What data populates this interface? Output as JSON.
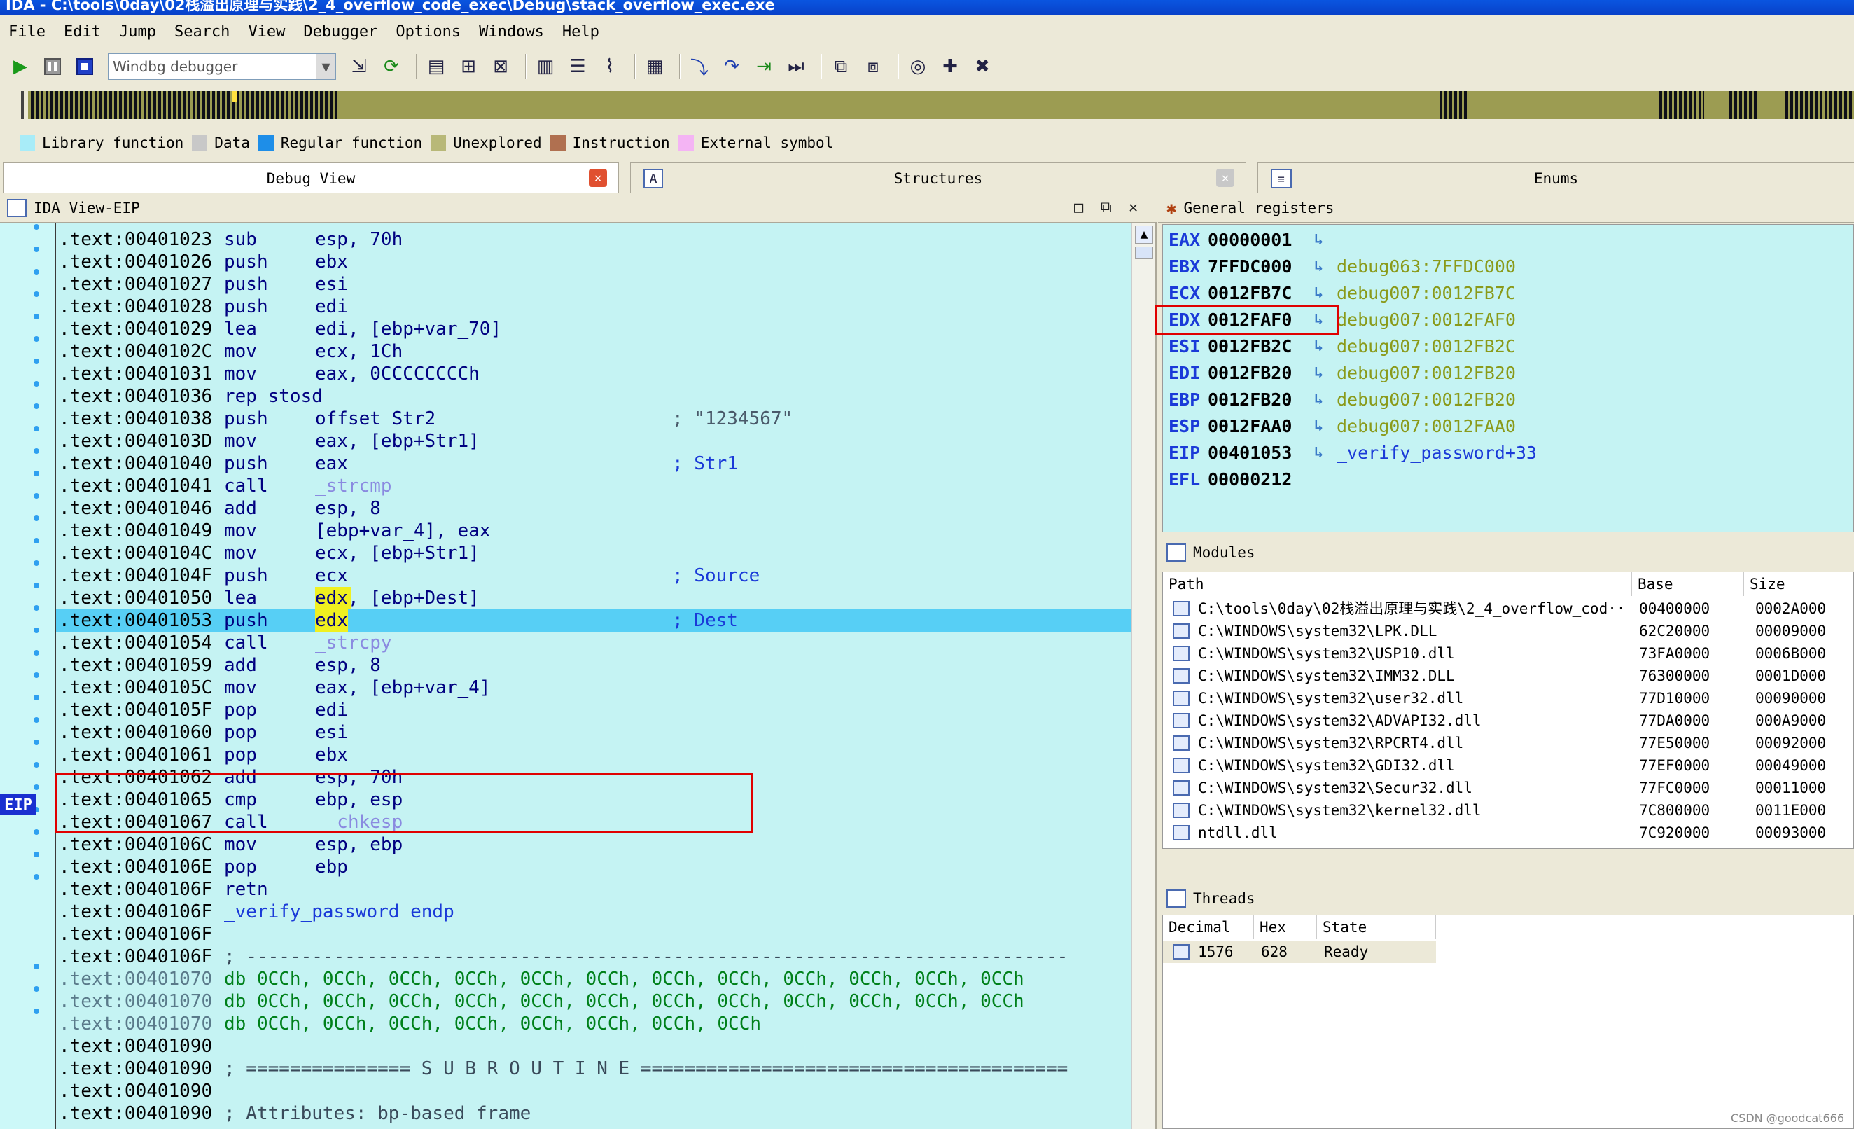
{
  "title": "IDA - C:\\tools\\0day\\02栈溢出原理与实践\\2_4_overflow_code_exec\\Debug\\stack_overflow_exec.exe",
  "menu": [
    "File",
    "Edit",
    "Jump",
    "Search",
    "View",
    "Debugger",
    "Options",
    "Windows",
    "Help"
  ],
  "toolbar": {
    "debugger_select": "Windbg debugger"
  },
  "legend": [
    {
      "label": "Library function",
      "color": "#a8ecf8"
    },
    {
      "label": "Data",
      "color": "#c8c8c8"
    },
    {
      "label": "Regular function",
      "color": "#1e8ee8"
    },
    {
      "label": "Unexplored",
      "color": "#b8b878"
    },
    {
      "label": "Instruction",
      "color": "#b07050"
    },
    {
      "label": "External symbol",
      "color": "#f4b4f4"
    }
  ],
  "tabs": {
    "debug_view": "Debug View",
    "structures": "Structures",
    "enums": "Enums"
  },
  "ida_view": {
    "title": "IDA View-EIP",
    "eip_label": "EIP"
  },
  "code": [
    {
      "a": ".text:00401023",
      "m": "sub",
      "o": "esp, 70h",
      "c": ""
    },
    {
      "a": ".text:00401026",
      "m": "push",
      "o": "ebx",
      "c": ""
    },
    {
      "a": ".text:00401027",
      "m": "push",
      "o": "esi",
      "c": ""
    },
    {
      "a": ".text:00401028",
      "m": "push",
      "o": "edi",
      "c": ""
    },
    {
      "a": ".text:00401029",
      "m": "lea",
      "o": "edi, [ebp+var_70]",
      "c": ""
    },
    {
      "a": ".text:0040102C",
      "m": "mov",
      "o": "ecx, 1Ch",
      "c": ""
    },
    {
      "a": ".text:00401031",
      "m": "mov",
      "o": "eax, 0CCCCCCCCh",
      "c": ""
    },
    {
      "a": ".text:00401036",
      "m": "rep stosd",
      "o": "",
      "c": ""
    },
    {
      "a": ".text:00401038",
      "m": "push",
      "o": "offset Str2",
      "c": "; \"1234567\""
    },
    {
      "a": ".text:0040103D",
      "m": "mov",
      "o": "eax, [ebp+Str1]",
      "c": ""
    },
    {
      "a": ".text:00401040",
      "m": "push",
      "o": "eax",
      "c": "; Str1"
    },
    {
      "a": ".text:00401041",
      "m": "call",
      "o": "_strcmp",
      "c": ""
    },
    {
      "a": ".text:00401046",
      "m": "add",
      "o": "esp, 8",
      "c": ""
    },
    {
      "a": ".text:00401049",
      "m": "mov",
      "o": "[ebp+var_4], eax",
      "c": ""
    },
    {
      "a": ".text:0040104C",
      "m": "mov",
      "o": "ecx, [ebp+Str1]",
      "c": ""
    },
    {
      "a": ".text:0040104F",
      "m": "push",
      "o": "ecx",
      "c": "; Source"
    },
    {
      "a": ".text:00401050",
      "m": "lea",
      "o": "edx, [ebp+Dest]",
      "c": ""
    },
    {
      "a": ".text:00401053",
      "m": "push",
      "o": "edx",
      "c": "; Dest"
    },
    {
      "a": ".text:00401054",
      "m": "call",
      "o": "_strcpy",
      "c": ""
    },
    {
      "a": ".text:00401059",
      "m": "add",
      "o": "esp, 8",
      "c": ""
    },
    {
      "a": ".text:0040105C",
      "m": "mov",
      "o": "eax, [ebp+var_4]",
      "c": ""
    },
    {
      "a": ".text:0040105F",
      "m": "pop",
      "o": "edi",
      "c": ""
    },
    {
      "a": ".text:00401060",
      "m": "pop",
      "o": "esi",
      "c": ""
    },
    {
      "a": ".text:00401061",
      "m": "pop",
      "o": "ebx",
      "c": ""
    },
    {
      "a": ".text:00401062",
      "m": "add",
      "o": "esp, 70h",
      "c": ""
    },
    {
      "a": ".text:00401065",
      "m": "cmp",
      "o": "ebp, esp",
      "c": ""
    },
    {
      "a": ".text:00401067",
      "m": "call",
      "o": "__chkesp",
      "c": ""
    },
    {
      "a": ".text:0040106C",
      "m": "mov",
      "o": "esp, ebp",
      "c": ""
    },
    {
      "a": ".text:0040106E",
      "m": "pop",
      "o": "ebp",
      "c": ""
    },
    {
      "a": ".text:0040106F",
      "m": "retn",
      "o": "",
      "c": ""
    },
    {
      "a": ".text:0040106F",
      "m": "_verify_password endp",
      "o": "",
      "c": ""
    },
    {
      "a": ".text:0040106F",
      "m": "",
      "o": "",
      "c": ""
    },
    {
      "a": ".text:0040106F",
      "m": "; ---------------------------------------------------------------------------",
      "o": "",
      "c": ""
    },
    {
      "a": ".text:00401070",
      "m": "db 0CCh, 0CCh, 0CCh, 0CCh, 0CCh, 0CCh, 0CCh, 0CCh, 0CCh, 0CCh, 0CCh, 0CCh",
      "o": "",
      "c": ""
    },
    {
      "a": ".text:00401070",
      "m": "db 0CCh, 0CCh, 0CCh, 0CCh, 0CCh, 0CCh, 0CCh, 0CCh, 0CCh, 0CCh, 0CCh, 0CCh",
      "o": "",
      "c": ""
    },
    {
      "a": ".text:00401070",
      "m": "db 0CCh, 0CCh, 0CCh, 0CCh, 0CCh, 0CCh, 0CCh, 0CCh",
      "o": "",
      "c": ""
    },
    {
      "a": ".text:00401090",
      "m": "",
      "o": "",
      "c": ""
    },
    {
      "a": ".text:00401090",
      "m": "; =============== S U B R O U T I N E =======================================",
      "o": "",
      "c": ""
    },
    {
      "a": ".text:00401090",
      "m": "",
      "o": "",
      "c": ""
    },
    {
      "a": ".text:00401090",
      "m": "; Attributes: bp-based frame",
      "o": "",
      "c": ""
    }
  ],
  "registers_title": "General registers",
  "registers": [
    {
      "n": "EAX",
      "v": "00000001",
      "t": ""
    },
    {
      "n": "EBX",
      "v": "7FFDC000",
      "t": "debug063:7FFDC000"
    },
    {
      "n": "ECX",
      "v": "0012FB7C",
      "t": "debug007:0012FB7C"
    },
    {
      "n": "EDX",
      "v": "0012FAF0",
      "t": "debug007:0012FAF0"
    },
    {
      "n": "ESI",
      "v": "0012FB2C",
      "t": "debug007:0012FB2C"
    },
    {
      "n": "EDI",
      "v": "0012FB20",
      "t": "debug007:0012FB20"
    },
    {
      "n": "EBP",
      "v": "0012FB20",
      "t": "debug007:0012FB20"
    },
    {
      "n": "ESP",
      "v": "0012FAA0",
      "t": "debug007:0012FAA0"
    },
    {
      "n": "EIP",
      "v": "00401053",
      "t": "_verify_password+33"
    },
    {
      "n": "EFL",
      "v": "00000212",
      "t": ""
    }
  ],
  "modules_title": "Modules",
  "modules_cols": [
    "Path",
    "Base",
    "Size"
  ],
  "modules": [
    {
      "p": "C:\\tools\\0day\\02栈溢出原理与实践\\2_4_overflow_cod···",
      "b": "00400000",
      "s": "0002A000"
    },
    {
      "p": "C:\\WINDOWS\\system32\\LPK.DLL",
      "b": "62C20000",
      "s": "00009000"
    },
    {
      "p": "C:\\WINDOWS\\system32\\USP10.dll",
      "b": "73FA0000",
      "s": "0006B000"
    },
    {
      "p": "C:\\WINDOWS\\system32\\IMM32.DLL",
      "b": "76300000",
      "s": "0001D000"
    },
    {
      "p": "C:\\WINDOWS\\system32\\user32.dll",
      "b": "77D10000",
      "s": "00090000"
    },
    {
      "p": "C:\\WINDOWS\\system32\\ADVAPI32.dll",
      "b": "77DA0000",
      "s": "000A9000"
    },
    {
      "p": "C:\\WINDOWS\\system32\\RPCRT4.dll",
      "b": "77E50000",
      "s": "00092000"
    },
    {
      "p": "C:\\WINDOWS\\system32\\GDI32.dll",
      "b": "77EF0000",
      "s": "00049000"
    },
    {
      "p": "C:\\WINDOWS\\system32\\Secur32.dll",
      "b": "77FC0000",
      "s": "00011000"
    },
    {
      "p": "C:\\WINDOWS\\system32\\kernel32.dll",
      "b": "7C800000",
      "s": "0011E000"
    },
    {
      "p": "ntdll.dll",
      "b": "7C920000",
      "s": "00093000"
    }
  ],
  "threads_title": "Threads",
  "threads_cols": [
    "Decimal",
    "Hex",
    "State"
  ],
  "threads": [
    {
      "d": "1576",
      "h": "628",
      "st": "Ready"
    }
  ],
  "watermark": "CSDN @goodcat666"
}
